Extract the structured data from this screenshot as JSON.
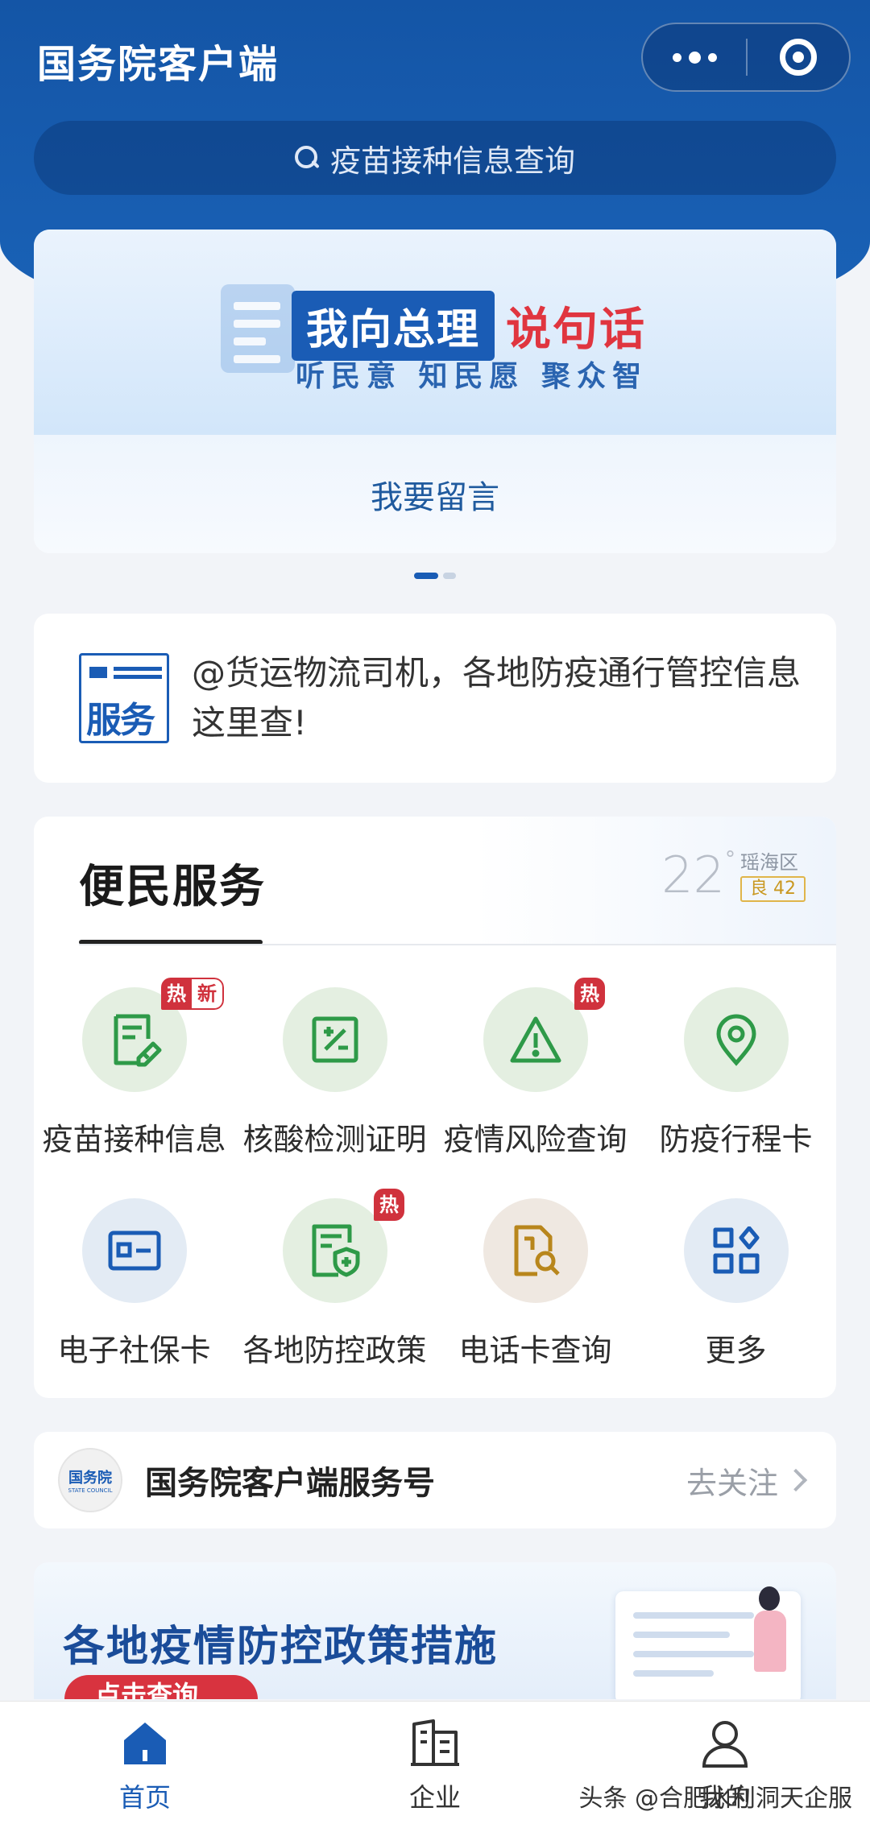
{
  "header": {
    "title": "国务院客户端"
  },
  "search": {
    "text": "疫苗接种信息查询"
  },
  "banner": {
    "title_left": "我向总理",
    "title_right": "说句话",
    "subtitle": "听民意 知民愿 聚众智",
    "action": "我要留言"
  },
  "notice": {
    "icon_text": "服务",
    "text": "@货运物流司机，各地防疫通行管控信息这里查!"
  },
  "services": {
    "title": "便民服务",
    "weather": {
      "temp": "22",
      "unit": "°",
      "district": "瑶海区",
      "aqi": "良 42"
    },
    "items": [
      {
        "label": "疫苗接种信息",
        "icon": "vaccine-record-icon",
        "badge_hot": "热",
        "badge_new": "新"
      },
      {
        "label": "核酸检测证明",
        "icon": "test-certificate-icon"
      },
      {
        "label": "疫情风险查询",
        "icon": "warning-triangle-icon",
        "badge_hot": "热"
      },
      {
        "label": "防疫行程卡",
        "icon": "location-pin-icon"
      },
      {
        "label": "电子社保卡",
        "icon": "social-security-card-icon"
      },
      {
        "label": "各地防控政策",
        "icon": "policy-shield-icon",
        "badge_hot": "热"
      },
      {
        "label": "电话卡查询",
        "icon": "sim-card-search-icon"
      },
      {
        "label": "更多",
        "icon": "more-grid-icon"
      }
    ]
  },
  "follow": {
    "logo_text": "国务院",
    "logo_subtext": "STATE COUNCIL",
    "name": "国务院客户端服务号",
    "action": "去关注"
  },
  "promo": {
    "title": "各地疫情防控政策措施",
    "button": "点击查询"
  },
  "tabbar": {
    "items": [
      {
        "label": "首页",
        "icon": "home-icon",
        "active": true
      },
      {
        "label": "企业",
        "icon": "building-icon",
        "active": false
      },
      {
        "label": "我的",
        "icon": "user-icon",
        "active": false
      }
    ]
  },
  "watermark": "头条 @合肥水利洞天企服",
  "colors": {
    "primary": "#1a5cb5",
    "hot": "#d0323d",
    "green_icon": "#2e9a48",
    "blue_icon": "#1a5cb5",
    "gold_icon": "#b8861c"
  }
}
